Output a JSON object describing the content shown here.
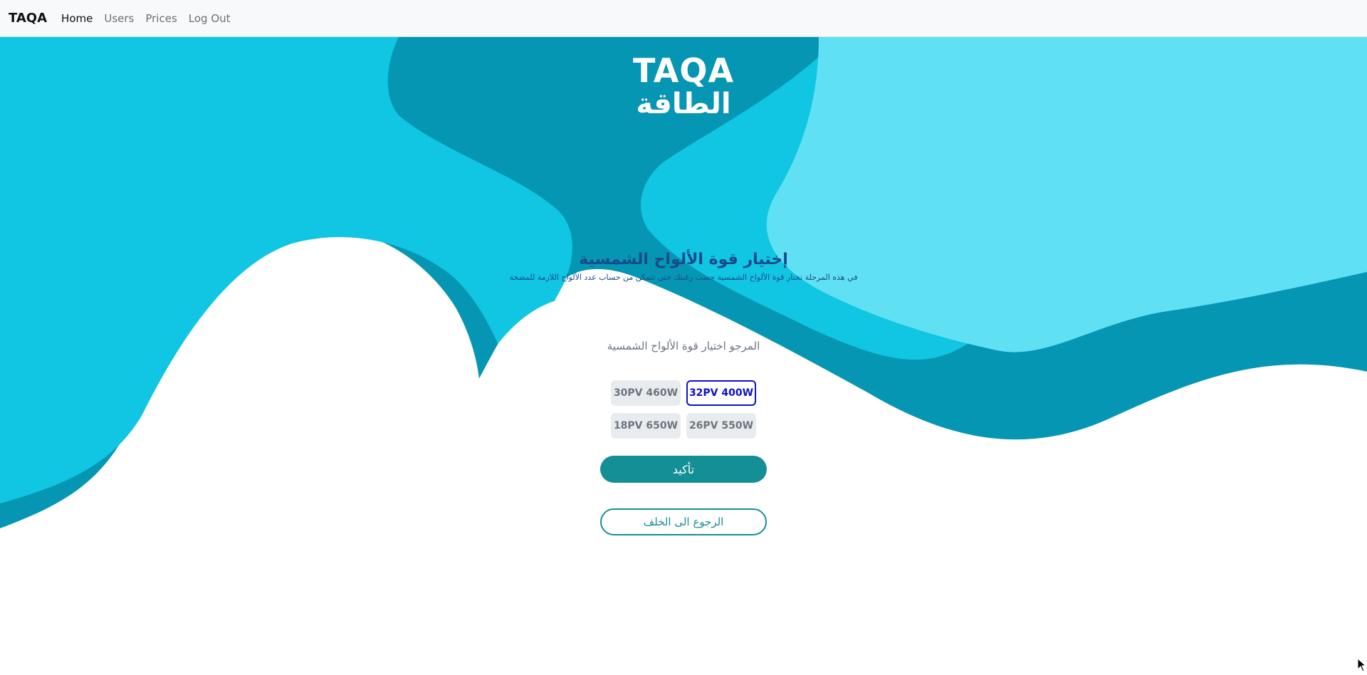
{
  "navbar": {
    "brand": "TAQA",
    "links": [
      "Home",
      "Users",
      "Prices",
      "Log Out"
    ],
    "active": "Home"
  },
  "logo": {
    "latin": "TAQA",
    "arabic": "الطاقة"
  },
  "page": {
    "title": "إختيار قوة الألواح الشمسية",
    "subtitle": "في هذه المرحلة تختار قوة الألواح الشمسية حسب رغبتك حتى تتمكن من حساب عدد الألواح اللازمة للمضخة",
    "prompt": "المرجو اختيار قوة الألواح الشمسية"
  },
  "options": [
    "30PV 460W",
    "32PV 400W",
    "18PV 650W",
    "26PV 550W"
  ],
  "selected_option": "32PV 400W",
  "buttons": {
    "confirm": "تأكيد",
    "back": "الرجوع الى الخلف"
  },
  "colors": {
    "cyan_light": "#5fe0f3",
    "cyan_mid": "#10c6e2",
    "teal_dark": "#0596b4",
    "button_teal": "#148f96",
    "title_blue": "#1a4a8c",
    "selected_blue": "#1010c8"
  },
  "icons": {
    "cursor": "mouse-pointer-icon"
  }
}
